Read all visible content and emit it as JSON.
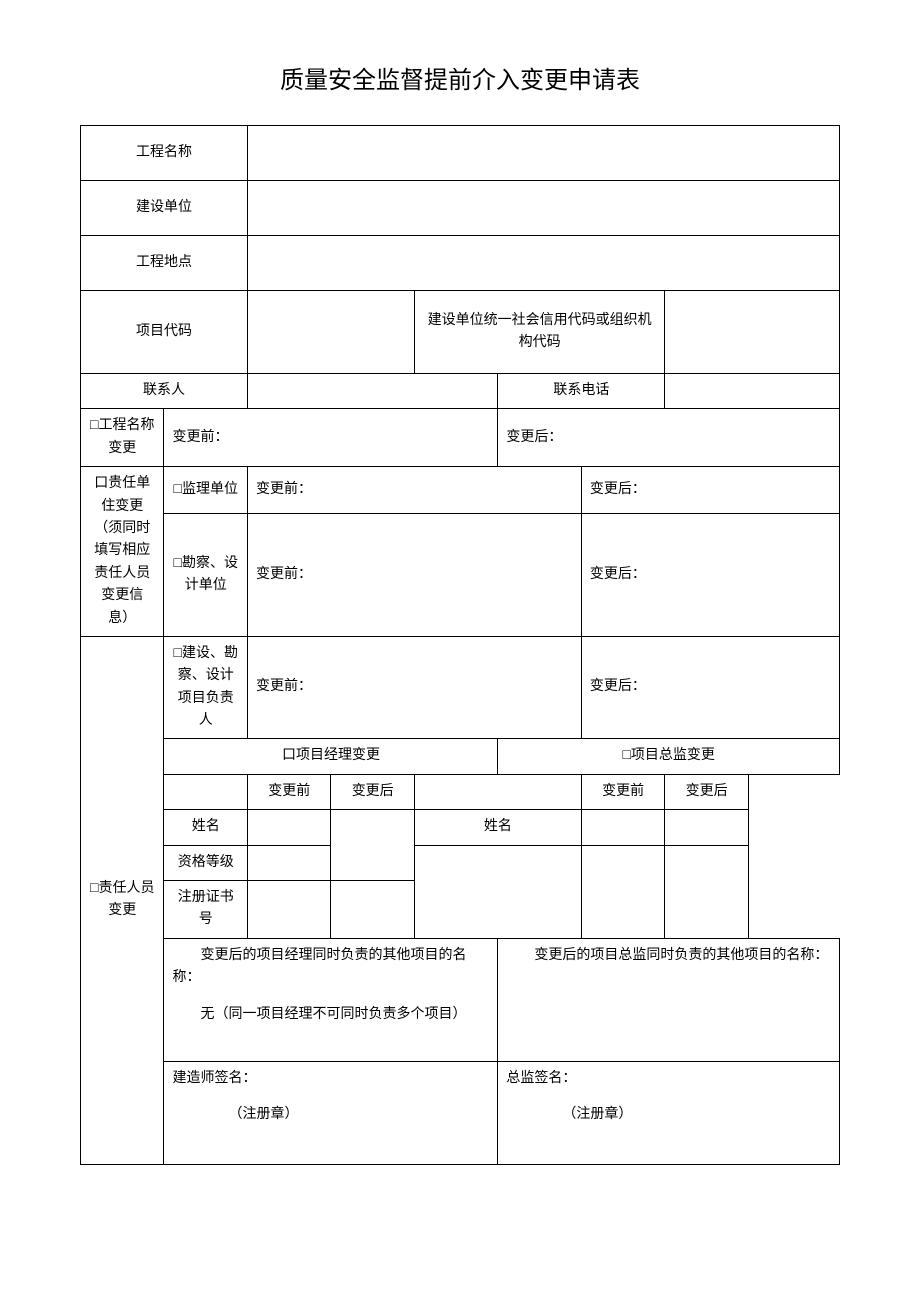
{
  "title": "质量安全监督提前介入变更申请表",
  "rows": {
    "project_name_label": "工程名称",
    "construction_unit_label": "建设单位",
    "project_location_label": "工程地点",
    "project_code_label": "项目代码",
    "unit_credit_code_label": "建设单位统一社会信用代码或组织机构代码",
    "contact_person_label": "联系人",
    "contact_phone_label": "联系电话"
  },
  "name_change": {
    "section_label": "□工程名称变更",
    "before_label": "变更前：",
    "after_label": "变更后："
  },
  "unit_change": {
    "section_label": "口贵任单住变更（须同时\n填写相应责任人员变更信\n息）",
    "supervision_unit_label": "□监理单位",
    "survey_design_unit_label": "□勘察、设计单位",
    "before_label": "变更前：",
    "after_label": "变更后："
  },
  "person_change": {
    "section_label": "□责任人员变更",
    "build_survey_design_leader_label": "□建设、勘察、设计项目负责人",
    "before_label": "变更前：",
    "after_label": "变更后：",
    "pm_change_label": "口项目经理变更",
    "director_change_label": "□项目总监变更",
    "col_before": "变更前",
    "col_after": "变更后",
    "name_label": "姓名",
    "grade_label": "资格等级",
    "cert_no_label": "注册证书号",
    "other_pm_projects_label": "变更后的项目经理同时负责的其他项目的名称：",
    "other_pm_projects_note": "无（同一项目经理不可同时负责多个项目）",
    "other_director_projects_label": "变更后的项目总监同时负责的其他项目的名称：",
    "builder_sign_label": "建造师签名：",
    "director_sign_label": "总监签名：",
    "seal_note_a": "（注册章）",
    "seal_note_b": "（注册章）"
  }
}
